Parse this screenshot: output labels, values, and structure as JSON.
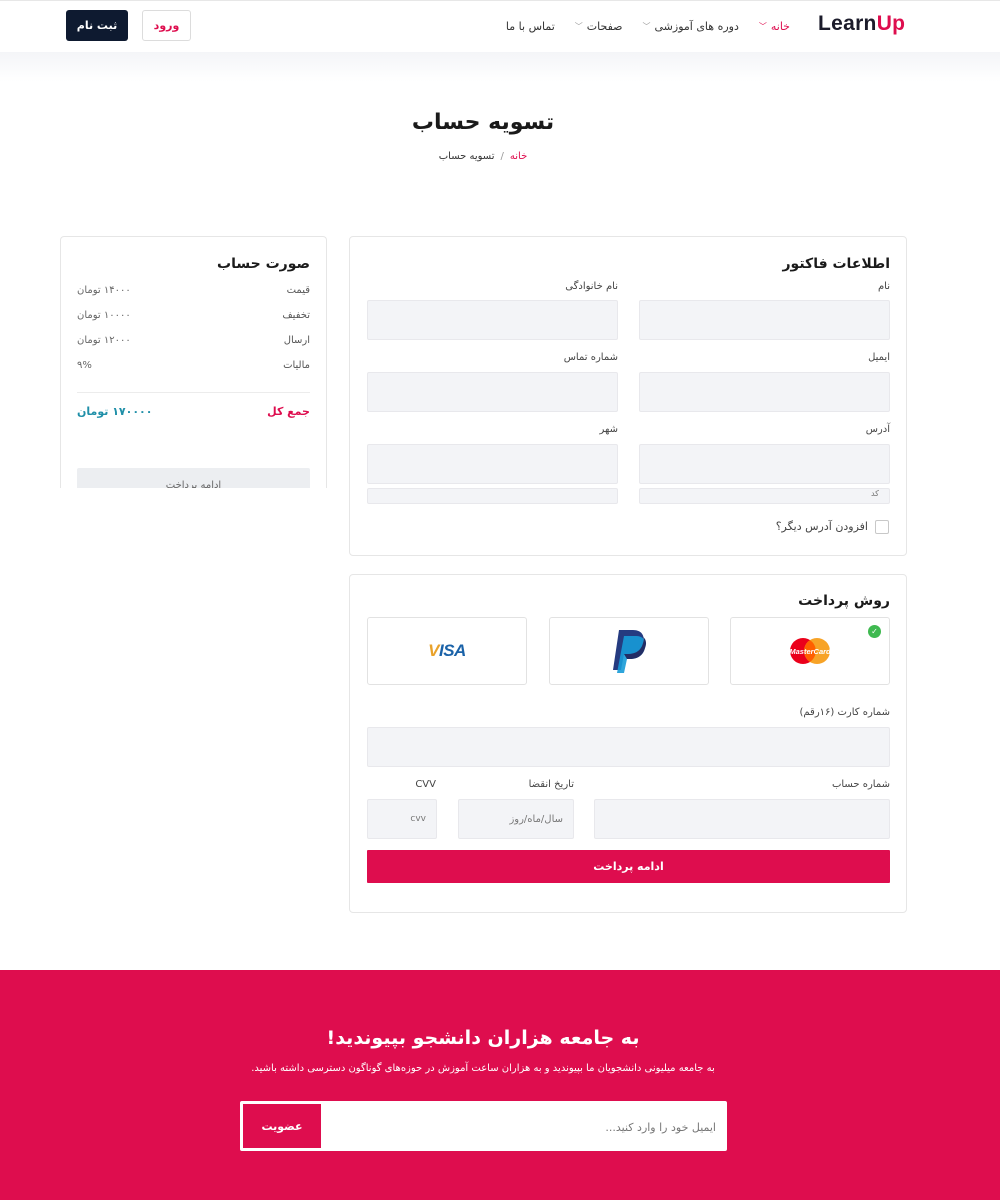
{
  "header": {
    "logo_part1": "Learn",
    "logo_part2": "Up",
    "nav": [
      {
        "label": "خانه",
        "has_dropdown": true,
        "active": true
      },
      {
        "label": "دوره های آموزشی",
        "has_dropdown": true,
        "active": false
      },
      {
        "label": "صفحات",
        "has_dropdown": true,
        "active": false
      },
      {
        "label": "تماس با ما",
        "has_dropdown": false,
        "active": false
      }
    ],
    "login_label": "ورود",
    "signup_label": "ثبت نام"
  },
  "page": {
    "title": "تسویه حساب",
    "breadcrumb_home": "خانه",
    "breadcrumb_sep": "/",
    "breadcrumb_current": "تسویه حساب"
  },
  "billing": {
    "title": "اطلاعات فاکتور",
    "first_name_label": "نام",
    "last_name_label": "نام خانوادگی",
    "email_label": "ایمیل",
    "phone_label": "شماره تماس",
    "address_label": "آدرس",
    "city_label": "شهر",
    "add_address_label": "افزودن آدرس دیگر؟",
    "clipped_field_text": "کد"
  },
  "summary": {
    "title": "صورت حساب",
    "rows": [
      {
        "label": "قیمت",
        "value": "۱۴۰۰۰ تومان"
      },
      {
        "label": "تخفیف",
        "value": "۱۰۰۰۰ تومان"
      },
      {
        "label": "ارسال",
        "value": "۱۲۰۰۰ تومان"
      },
      {
        "label": "مالیات",
        "value": "۹%"
      }
    ],
    "total_label": "جمع کل",
    "total_value": "۱۷۰۰۰۰ تومان",
    "button_label": "ادامه پرداخت"
  },
  "payment": {
    "title": "روش پرداخت",
    "methods": [
      "MasterCard",
      "PayPal",
      "VISA"
    ],
    "selected": "MasterCard",
    "card_number_label": "شماره کارت (۱۶رقم)",
    "account_number_label": "شماره حساب",
    "expiry_label": "تاریخ انقضا",
    "expiry_placeholder": "سال/ماه/روز",
    "cvv_label": "CVV",
    "cvv_placeholder": "cvv",
    "submit_label": "ادامه پرداخت"
  },
  "cta": {
    "title": "به جامعه هزاران دانشجو بپیوندید!",
    "subtitle": "به جامعه میلیونی دانشجویان ما بپیوندید و به هزاران ساعت آموزش در حوزه‌های گوناگون دسترسی داشته باشید.",
    "email_placeholder": "ایمیل خود را وارد کنید...",
    "button_label": "عضویت"
  },
  "colors": {
    "brand": "#de0d4e",
    "navy": "#0e1a30",
    "field_bg": "#f3f4f7",
    "total_value": "#1f8fa8",
    "success": "#3fb950"
  }
}
